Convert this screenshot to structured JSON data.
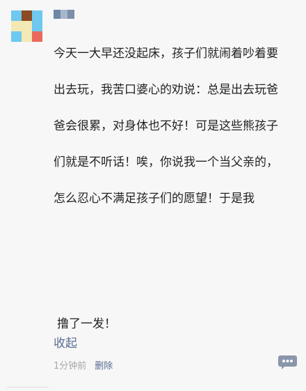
{
  "avatar": {
    "colors": [
      "#6ec8ef",
      "#8b4a22",
      "#6ec8ef",
      "#f3e9b4",
      "#f3e9b4",
      "#6ec8ef",
      "#6ec8ef",
      "#f3e9b4",
      "#e96a5c"
    ]
  },
  "username_blur_colors": [
    "#6f86a6",
    "#a6b7cc",
    "#7d8fa8"
  ],
  "post": {
    "lines": [
      "今天一大早还没起床，孩子们就闹着吵着要",
      "出去玩，我苦口婆心的劝说：总是出去玩爸",
      "爸会很累，对身体也不好！可是这些熊孩子",
      "们就是不听话！唉，你说我一个当父亲的，",
      "怎么忍心不满足孩子们的愿望！于是我"
    ],
    "punchline": "撸了一发！",
    "collapse_label": "收起"
  },
  "meta": {
    "time": "1分钟前",
    "delete_label": "删除"
  },
  "colors": {
    "link": "#5a6d92",
    "text": "#222222",
    "meta": "#a8a8a8",
    "comment_button": "#8b95ab"
  },
  "icons": {
    "comment": "comment-dots-icon"
  }
}
